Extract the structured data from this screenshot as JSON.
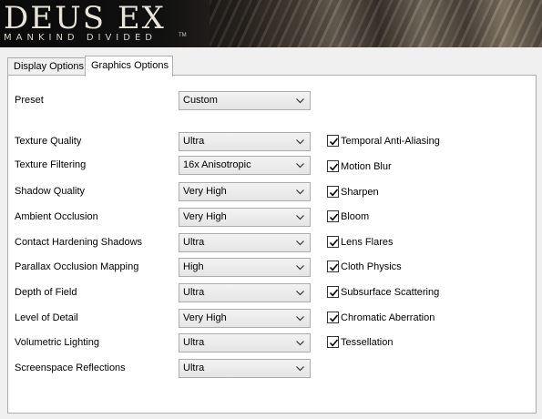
{
  "banner": {
    "title": "DEUS EX",
    "subtitle": "MANKIND DIVIDED",
    "trademark": "TM"
  },
  "tabs": [
    {
      "label": "Display Options",
      "active": false
    },
    {
      "label": "Graphics Options",
      "active": true
    }
  ],
  "preset": {
    "label": "Preset",
    "value": "Custom"
  },
  "settings": [
    {
      "label": "Texture Quality",
      "value": "Ultra"
    },
    {
      "label": "Texture Filtering",
      "value": "16x Anisotropic"
    },
    {
      "label": "Shadow Quality",
      "value": "Very High"
    },
    {
      "label": "Ambient Occlusion",
      "value": "Very High"
    },
    {
      "label": "Contact Hardening Shadows",
      "value": "Ultra"
    },
    {
      "label": "Parallax Occlusion Mapping",
      "value": "High"
    },
    {
      "label": "Depth of Field",
      "value": "Ultra"
    },
    {
      "label": "Level of Detail",
      "value": "Very High"
    },
    {
      "label": "Volumetric Lighting",
      "value": "Ultra"
    },
    {
      "label": "Screenspace Reflections",
      "value": "Ultra"
    }
  ],
  "toggles": [
    {
      "label": "Temporal Anti-Aliasing",
      "checked": true
    },
    {
      "label": "Motion Blur",
      "checked": true
    },
    {
      "label": "Sharpen",
      "checked": true
    },
    {
      "label": "Bloom",
      "checked": true
    },
    {
      "label": "Lens Flares",
      "checked": true
    },
    {
      "label": "Cloth Physics",
      "checked": true
    },
    {
      "label": "Subsurface Scattering",
      "checked": true
    },
    {
      "label": "Chromatic Aberration",
      "checked": true
    },
    {
      "label": "Tessellation",
      "checked": true
    }
  ],
  "icons": {
    "dropdown": "chevron-down-icon",
    "check": "checkmark-icon"
  }
}
